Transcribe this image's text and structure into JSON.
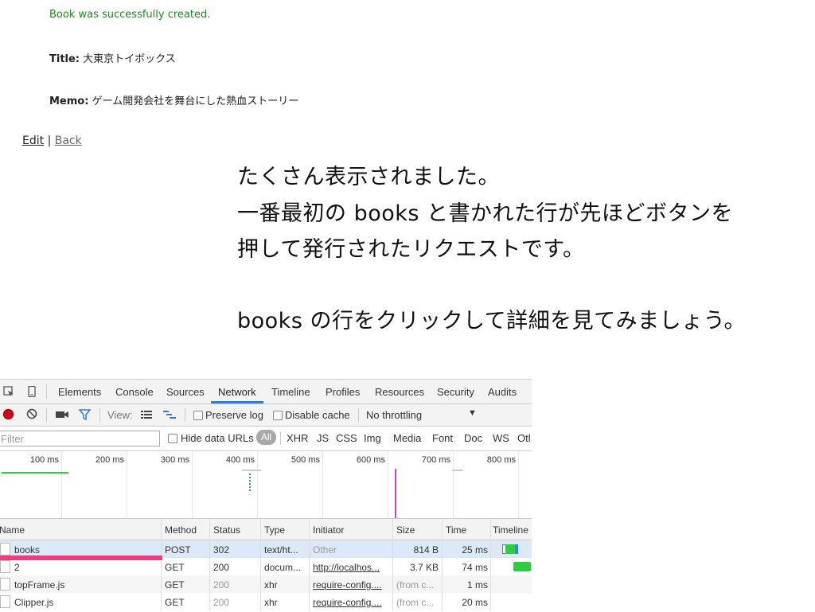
{
  "app": {
    "notice": "Book was successfully created.",
    "title_label": "Title:",
    "title_value": "大東京トイボックス",
    "memo_label": "Memo:",
    "memo_value": "ゲーム開発会社を舞台にした熱血ストーリー",
    "edit_link": "Edit",
    "separator": "|",
    "back_link": "Back"
  },
  "caption": {
    "lines": [
      "たくさん表示されました。",
      "一番最初の books と書かれた行が先ほどボタンを",
      "押して発行されたリクエストです。",
      "books の行をクリックして詳細を見てみましょう。"
    ]
  },
  "devtools": {
    "tabs": [
      "Elements",
      "Console",
      "Sources",
      "Network",
      "Timeline",
      "Profiles",
      "Resources",
      "Security",
      "Audits"
    ],
    "active_tab": "Network",
    "toolbar": {
      "view_label": "View:",
      "preserve_log": "Preserve log",
      "disable_cache": "Disable cache",
      "throttling": "No throttling"
    },
    "filter": {
      "placeholder": "Filter",
      "hide_data_urls": "Hide data URLs",
      "types": [
        "All",
        "XHR",
        "JS",
        "CSS",
        "Img",
        "Media",
        "Font",
        "Doc",
        "WS",
        "Otl"
      ]
    },
    "overview_ticks": [
      "100 ms",
      "200 ms",
      "300 ms",
      "400 ms",
      "500 ms",
      "600 ms",
      "700 ms",
      "800 ms"
    ],
    "columns": [
      "Name",
      "Method",
      "Status",
      "Type",
      "Initiator",
      "Size",
      "Time",
      "Timeline"
    ],
    "rows": [
      {
        "name": "books",
        "method": "POST",
        "status": "302",
        "type": "text/ht...",
        "initiator": "Other",
        "size": "814 B",
        "time": "25 ms"
      },
      {
        "name": "2",
        "method": "GET",
        "status": "200",
        "type": "docum...",
        "initiator": "http://localhos...",
        "size": "3.7 KB",
        "time": "74 ms"
      },
      {
        "name": "topFrame.js",
        "method": "GET",
        "status": "200",
        "type": "xhr",
        "initiator": "require-config....",
        "size": "(from c...",
        "time": "1 ms"
      },
      {
        "name": "Clipper.js",
        "method": "GET",
        "status": "200",
        "type": "xhr",
        "initiator": "require-config....",
        "size": "(from c...",
        "time": "20 ms"
      }
    ],
    "colors": {
      "accent": "#3879d9",
      "record": "#d0021b",
      "highlight": "#ec3d82",
      "selected_row": "#dbe9f9"
    }
  }
}
